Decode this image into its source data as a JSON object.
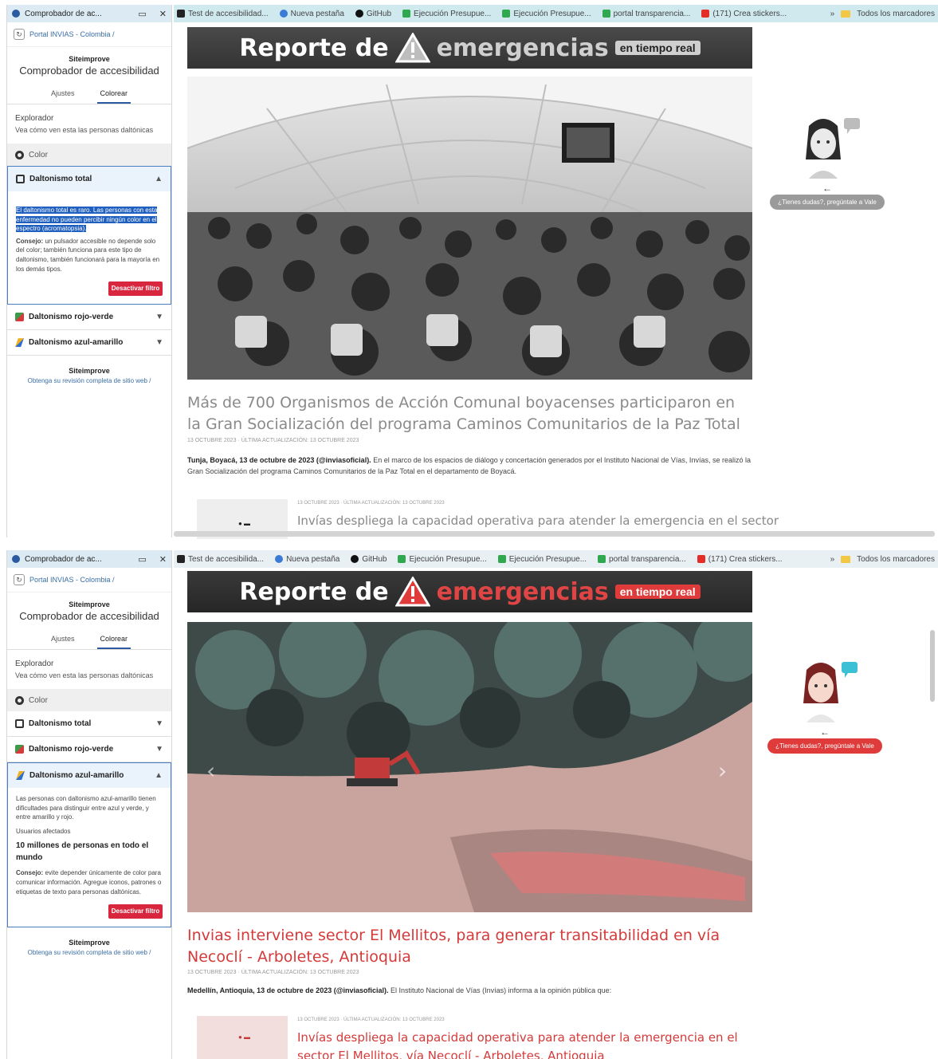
{
  "screens": [
    {
      "bookmarks": [
        "Test de accesibilidad...",
        "Nueva pestaña",
        "GitHub",
        "Ejecución Presupue...",
        "Ejecución Presupue...",
        "portal transparencia...",
        "(171) Crea stickers..."
      ],
      "bookmarks_right": "Todos los marcadores",
      "extension": {
        "window_title": "Comprobador de ac...",
        "url": "Portal INVIAS - Colombia /",
        "brand": "Siteimprove",
        "app_name": "Comprobador de accesibilidad",
        "tabs": [
          "Ajustes",
          "Colorear"
        ],
        "active_tab": 1,
        "explorer_title": "Explorador",
        "explorer_text": "Vea cómo ven esta las personas daltónicas",
        "color_label": "Color",
        "accordions": [
          {
            "label": "Daltonismo total",
            "open": true
          },
          {
            "label": "Daltonismo rojo-verde",
            "open": false
          },
          {
            "label": "Daltonismo azul-amarillo",
            "open": false
          }
        ],
        "open_selected_text": "El daltonismo total es raro. Las personas con esta enfermedad no pueden percibir ningún color en el espectro (acromatopsia).",
        "open_body_bold": "Consejo:",
        "open_body_text": "un pulsador accesible no depende solo del color; también funciona para este tipo de daltonismo, también funcionará para la mayoría en los demás tipos.",
        "button_label": "Desactivar filtro",
        "footer_brand": "Siteimprove",
        "footer_link": "Obtenga su revisión completa de sitio web /"
      },
      "banner": {
        "part1": "Reporte de",
        "part2": "emergencias",
        "tag": "en tiempo real"
      },
      "headline": "Más de 700 Organismos de Acción Comunal boyacenses participaron en la Gran Socialización del programa Caminos Comunitarios de la Paz Total",
      "date": "13 OCTUBRE 2023 · ÚLTIMA ACTUALIZACIÓN: 13 OCTUBRE 2023",
      "lead_bold": "Tunja, Boyacá, 13 de octubre de 2023 (@inviasoficial).",
      "lead_text": "En el marco de los espacios de diálogo y concertación generados por el Instituto Nacional de Vías, Invías, se realizó la Gran Socialización del programa Caminos Comunitarios de la Paz Total en el departamento de Boyacá.",
      "next_date": "13 OCTUBRE 2023 · ÚLTIMA ACTUALIZACIÓN: 13 OCTUBRE 2023",
      "next_title": "Invías despliega la capacidad operativa para atender la emergencia en el sector",
      "assistant_button": "¿Tienes dudas?, pregúntale a Vale"
    },
    {
      "bookmarks": [
        "Test de accesibilida...",
        "Nueva pestaña",
        "GitHub",
        "Ejecución Presupue...",
        "Ejecución Presupue...",
        "portal transparencia...",
        "(171) Crea stickers..."
      ],
      "bookmarks_right": "Todos los marcadores",
      "extension": {
        "window_title": "Comprobador de ac...",
        "url": "Portal INVIAS - Colombia /",
        "brand": "Siteimprove",
        "app_name": "Comprobador de accesibilidad",
        "tabs": [
          "Ajustes",
          "Colorear"
        ],
        "active_tab": 1,
        "explorer_title": "Explorador",
        "explorer_text": "Vea cómo ven esta las personas daltónicas",
        "color_label": "Color",
        "accordions": [
          {
            "label": "Daltonismo total",
            "open": false
          },
          {
            "label": "Daltonismo rojo-verde",
            "open": false
          },
          {
            "label": "Daltonismo azul-amarillo",
            "open": true
          }
        ],
        "open_body_text": "Las personas con daltonismo azul-amarillo tienen dificultades para distinguir entre azul y verde, y entre amarillo y rojo.",
        "affected_label": "Usuarios afectados",
        "affected_value": "10 millones de personas en todo el mundo",
        "tip_bold": "Consejo:",
        "tip_text": "evite depender únicamente de color para comunicar información. Agregue iconos, patrones o etiquetas de texto para personas daltónicas.",
        "button_label": "Desactivar filtro",
        "footer_brand": "Siteimprove",
        "footer_link": "Obtenga su revisión completa de sitio web /"
      },
      "banner": {
        "part1": "Reporte de",
        "part2": "emergencias",
        "tag": "en tiempo real"
      },
      "headline": "Invias interviene sector El Mellitos, para generar transitabilidad en vía Necoclí - Arboletes, Antioquia",
      "date": "13 OCTUBRE 2023 · ÚLTIMA ACTUALIZACIÓN: 13 OCTUBRE 2023",
      "lead_bold": "Medellín, Antioquia, 13 de octubre de 2023 (@inviasoficial).",
      "lead_text": "El Instituto Nacional de Vías (Invías) informa a la opinión pública que:",
      "next_date": "13 OCTUBRE 2023 · ÚLTIMA ACTUALIZACIÓN: 13 OCTUBRE 2023",
      "next_title": "Invías despliega la capacidad operativa para atender la emergencia en el sector El Mellitos, vía Necoclí - Arboletes, Antioquia",
      "assistant_button": "¿Tienes dudas?, pregúntale a Vale"
    }
  ]
}
